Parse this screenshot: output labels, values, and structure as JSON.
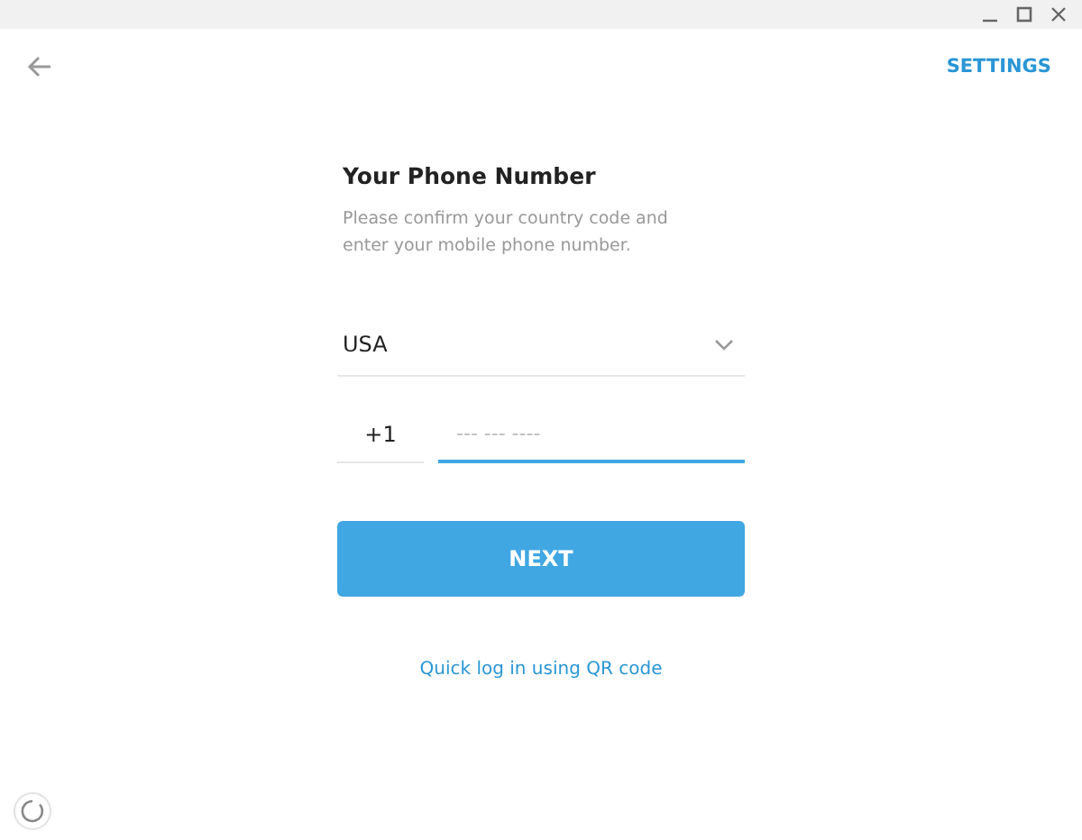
{
  "header": {
    "settings": "SETTINGS"
  },
  "form": {
    "title": "Your Phone Number",
    "description": "Please confirm your country code and enter your mobile phone number.",
    "country": "USA",
    "country_code": "+1",
    "phone": {
      "placeholder": "--- --- ----"
    }
  },
  "next_button": "NEXT",
  "qr_link": "Quick log in using QR code"
}
